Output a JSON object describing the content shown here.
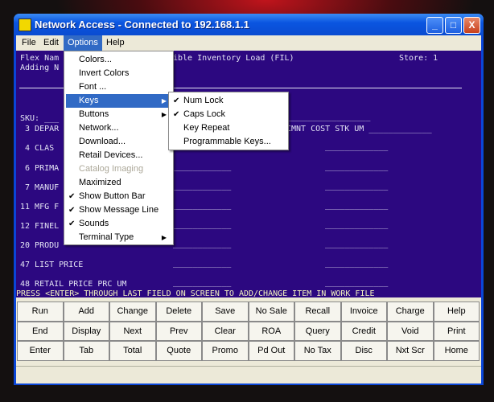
{
  "window": {
    "title": "Network Access - Connected to 192.168.1.1",
    "min": "_",
    "max": "□",
    "close": "X"
  },
  "menubar": [
    "File",
    "Edit",
    "Options",
    "Help"
  ],
  "terminal": {
    "header_left1": "Flex Nam",
    "header_mid": "ible Inventory Load (FIL)",
    "store": "Store: 1",
    "header_left2": "Adding N",
    "sku": "SKU: ___",
    "sku_dashes": "_________________",
    "line3_left": " 3 DEPAR",
    "line3_right": "CMNT COST STK UM _____________",
    "rows": [
      {
        "label": " 4 CLAS",
        "left": "",
        "right": "_____________"
      },
      {
        "label": " 6 PRIMA",
        "left": "____________",
        "right": "_____________"
      },
      {
        "label": " 7 MANUF",
        "left": "____________",
        "right": "_____________"
      },
      {
        "label": "11 MFG F",
        "left": "____________",
        "right": "_____________"
      },
      {
        "label": "12 FINEL",
        "left": "____________",
        "right": "_____________"
      },
      {
        "label": "20 PRODU",
        "left": "____________",
        "right": "_____________"
      },
      {
        "label": "47 LIST PRICE",
        "left": "____________",
        "right": "_____________"
      },
      {
        "label": "48 RETAIL PRICE PRC UM",
        "left": "____________",
        "right": "_____________"
      }
    ],
    "message": "PRESS <ENTER> THROUGH LAST FIELD ON SCREEN TO ADD/CHANGE ITEM IN WORK FILE"
  },
  "buttons": [
    [
      "Run",
      "Add",
      "Change",
      "Delete",
      "Save",
      "No Sale",
      "Recall",
      "Invoice",
      "Charge",
      "Help"
    ],
    [
      "End",
      "Display",
      "Next",
      "Prev",
      "Clear",
      "ROA",
      "Query",
      "Credit",
      "Void",
      "Print"
    ],
    [
      "Enter",
      "Tab",
      "Total",
      "Quote",
      "Promo",
      "Pd Out",
      "No Tax",
      "Disc",
      "Nxt Scr",
      "Home"
    ]
  ],
  "options_menu": [
    {
      "label": "Colors...",
      "checked": false
    },
    {
      "label": "Invert Colors",
      "checked": false
    },
    {
      "label": "Font ...",
      "checked": false
    },
    {
      "label": "Keys",
      "submenu": true,
      "highlighted": true
    },
    {
      "label": "Buttons",
      "submenu": true
    },
    {
      "label": "Network...",
      "checked": false
    },
    {
      "label": "Download...",
      "checked": false
    },
    {
      "label": "Retail Devices...",
      "checked": false
    },
    {
      "label": "Catalog Imaging",
      "disabled": true
    },
    {
      "label": "Maximized",
      "checked": false
    },
    {
      "label": "Show Button Bar",
      "checked": true
    },
    {
      "label": "Show Message Line",
      "checked": true
    },
    {
      "label": "Sounds",
      "checked": true
    },
    {
      "label": "Terminal Type",
      "submenu": true
    }
  ],
  "keys_submenu": [
    {
      "label": "Num Lock",
      "checked": true
    },
    {
      "label": "Caps Lock",
      "checked": true
    },
    {
      "label": "Key Repeat",
      "checked": false
    },
    {
      "label": "Programmable Keys...",
      "checked": false
    }
  ],
  "check_glyph": "✔",
  "arrow_glyph": "▶"
}
